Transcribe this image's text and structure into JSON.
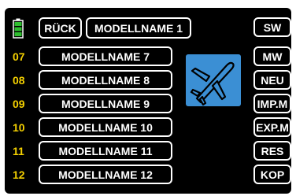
{
  "header": {
    "back_label": "RÜCK",
    "current_model": "MODELLNAME 1"
  },
  "models": [
    {
      "slot": "07",
      "name": "MODELLNAME 7"
    },
    {
      "slot": "08",
      "name": "MODELLNAME 8"
    },
    {
      "slot": "09",
      "name": "MODELLNAME 9"
    },
    {
      "slot": "10",
      "name": "MODELLNAME 10"
    },
    {
      "slot": "11",
      "name": "MODELLNAME 11"
    },
    {
      "slot": "12",
      "name": "MODELLNAME 12"
    }
  ],
  "side_buttons": [
    "SW",
    "MW",
    "NEU",
    "IMP.M",
    "EXP.M",
    "RES",
    "KOP"
  ],
  "icons": {
    "battery": "battery-icon",
    "model_type": "airplane-icon"
  },
  "colors": {
    "background": "#000000",
    "slot_number": "#f4d000",
    "battery": "#2fbf2f",
    "model_icon_bg": "#3b8fd4"
  }
}
